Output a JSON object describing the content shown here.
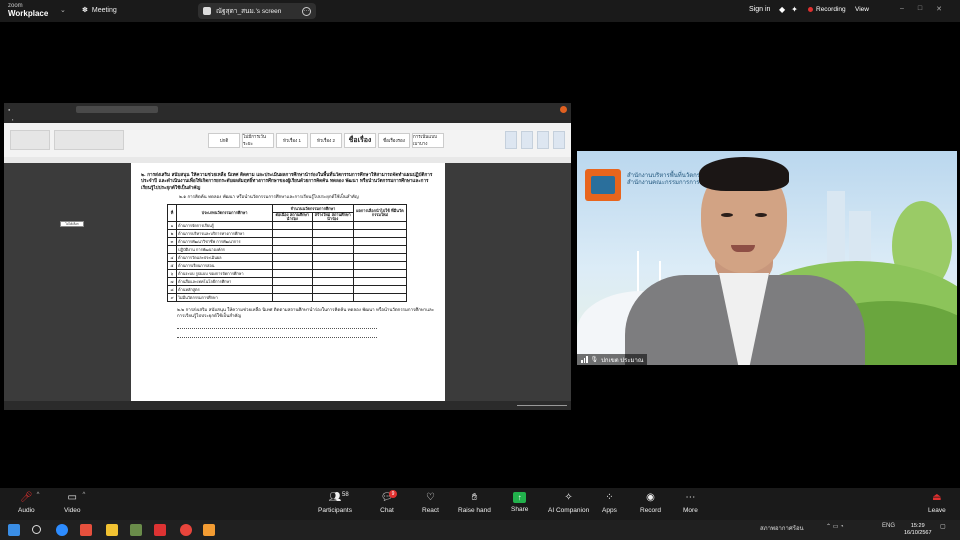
{
  "topbar": {
    "app_name_line1": "zoom",
    "app_name_line2": "Workplace",
    "meeting_label": "Meeting",
    "share_title": "ณัฐสุดา_สนม.'s screen",
    "sign_in": "Sign in",
    "recording": "Recording",
    "view": "View"
  },
  "shared_screen": {
    "ribbon_styles": [
      "ปกติ",
      "ไม่มีการเว้นระยะ",
      "หัวเรื่อง 1",
      "หัวเรื่อง 2",
      "ชื่อเรื่อง",
      "ชื่อเรื่องรอง",
      "การเน้นแบบเบาบาง"
    ],
    "side_label": "ไม่ได้เลือก",
    "doc": {
      "heading": "๒. การส่งเสริม สนับสนุน ให้ความช่วยเหลือ นิเทศ ติดตาม และประเมินผลการศึกษานำร่องในพื้นที่นวัตกรรมการศึกษาให้สามารถจัดทำแผนปฏิบัติการประจำปี และดำเนินงานเพื่อให้เกิดการยกระดับผลสัมฤทธิ์ทางการศึกษาของผู้เรียนด้วยการคิดค้น ทดลอง พัฒนา หรือนำนวัตกรรมการศึกษาและการเรียนรู้ไปประยุกต์ใช้เป็นสำคัญ",
      "subheading": "๒.๑ การคิดค้น ทดลอง พัฒนา หรือนำนวัตกรรมการศึกษาและการเรียนรู้ไปประยุกต์ใช้เป็นสำคัญ",
      "table_headers": {
        "no": "ที่",
        "item": "ประเภทนวัตกรรมการศึกษา",
        "count": "จำนวนนวัตกรรมการศึกษา",
        "col_a": "ต่อเนื่อง สถานศึกษานำร่อง",
        "col_b": "สร้างใหม่ สถานศึกษานำร่อง",
        "col_c": "ผลการเลือกนำไปใช้ ที่มีนวัตกรรมใหม่"
      },
      "rows": [
        {
          "no": "๑",
          "item": "ด้านการจัดการเรียนรู้"
        },
        {
          "no": "๒",
          "item": "ด้านการบริหารและบริการทางการศึกษา"
        },
        {
          "no": "๓",
          "item": "ด้านการพัฒนาวิชาชีพ การพัฒนาการ"
        },
        {
          "no": "",
          "item": "ปฏิบัติงาน การพัฒนาองค์กร"
        },
        {
          "no": "๔",
          "item": "ด้านการวัดและประเมินผล"
        },
        {
          "no": "๕",
          "item": "ด้านการเรียนการสอน"
        },
        {
          "no": "๖",
          "item": "ด้านระบบ รูปแบบ ของการจัดการศึกษา"
        },
        {
          "no": "๗",
          "item": "ด้านสื่อและเทคโนโลยีการศึกษา"
        },
        {
          "no": "๘",
          "item": "ด้านหลักสูตร"
        },
        {
          "no": "๙",
          "item": "ไม่มีนวัตกรรมการศึกษา"
        }
      ],
      "note": "๒.๒ การส่งเสริม สนับสนุน ให้ความช่วยเหลือ นิเทศ ติดตามสถานศึกษานำร่องในการคิดค้น ทดลอง พัฒนา หรือนำนวัตกรรมการศึกษาและการเรียนรู้ไปประยุกต์ใช้เป็นสำคัญ"
    }
  },
  "video": {
    "participant_name": "ปกเขต ประมาณ",
    "org_line1": "สำนักงานบริหารพื้นที่นวัตกรรม",
    "org_line2": "สำนักงานคณะกรรมการการศึกษาขั้นพื้นฐาน"
  },
  "toolbar": {
    "audio": "Audio",
    "video": "Video",
    "participants": "Participants",
    "participants_count": "58",
    "chat": "Chat",
    "chat_badge": "9",
    "react": "React",
    "raise_hand": "Raise hand",
    "share": "Share",
    "ai_companion": "AI Companion",
    "apps": "Apps",
    "record": "Record",
    "more": "More",
    "leave": "Leave"
  },
  "taskbar": {
    "weather": "สภาพอากาศร้อน",
    "lang": "ENG",
    "time": "15:29",
    "date": "16/10/2567"
  },
  "colors": {
    "recording": "#e0302f",
    "share_green": "#22b14c",
    "zoom_bar": "#1a1a1a"
  }
}
